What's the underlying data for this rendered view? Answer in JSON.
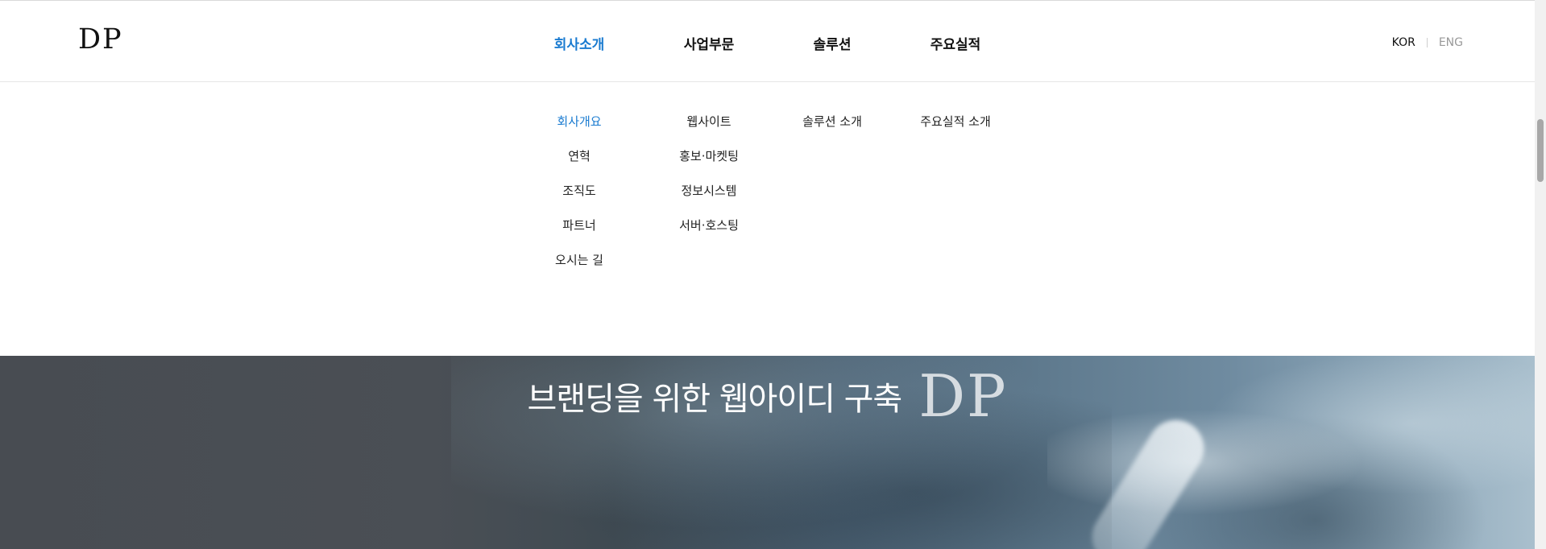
{
  "header": {
    "logo": "DP",
    "nav": [
      {
        "label": "회사소개",
        "active": true
      },
      {
        "label": "사업부문",
        "active": false
      },
      {
        "label": "솔루션",
        "active": false
      },
      {
        "label": "주요실적",
        "active": false
      }
    ],
    "lang": {
      "kor": "KOR",
      "eng": "ENG",
      "active": "KOR"
    }
  },
  "mega_menu": {
    "columns": [
      {
        "items": [
          "회사개요",
          "연혁",
          "조직도",
          "파트너",
          "오시는 길"
        ],
        "active_index": 0
      },
      {
        "items": [
          "웹사이트",
          "홍보·마켓팅",
          "정보시스템",
          "서버·호스팅"
        ]
      },
      {
        "items": [
          "솔루션 소개"
        ]
      },
      {
        "items": [
          "주요실적 소개"
        ]
      }
    ]
  },
  "hero": {
    "title": "브랜딩을 위한 웹아이디 구축",
    "mark": "DP"
  },
  "colors": {
    "accent": "#1a7bd0",
    "text": "#111111",
    "muted": "#999999"
  }
}
